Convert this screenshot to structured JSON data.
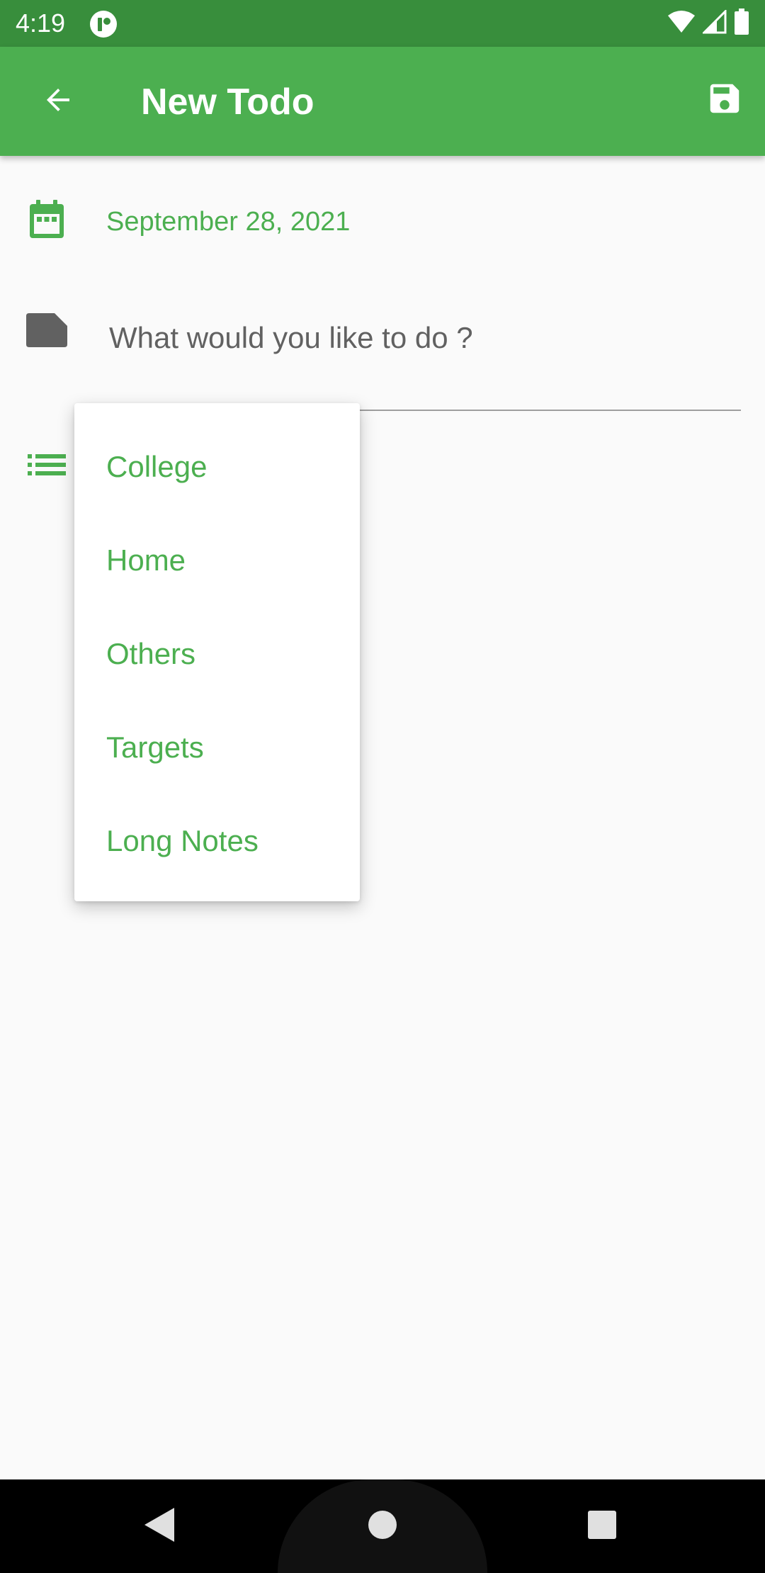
{
  "status_bar": {
    "time": "4:19",
    "icons": [
      "app-notification-icon",
      "wifi-icon",
      "cell-signal-icon",
      "battery-icon"
    ]
  },
  "app_bar": {
    "title": "New Todo",
    "back_icon": "arrow-back-icon",
    "save_icon": "save-icon"
  },
  "form": {
    "date": "September 28, 2021",
    "todo_placeholder": "What would you like to do ?",
    "todo_value": "",
    "category_icon": "list-icon"
  },
  "category_menu": {
    "items": [
      "College",
      "Home",
      "Others",
      "Targets",
      "Long Notes"
    ]
  },
  "nav_bar": {
    "icons": [
      "nav-back-icon",
      "nav-home-icon",
      "nav-recents-icon"
    ]
  },
  "colors": {
    "primary": "#4caf50",
    "primary_dark": "#388e3c",
    "background": "#fafafa",
    "icon_grey": "#616161"
  }
}
